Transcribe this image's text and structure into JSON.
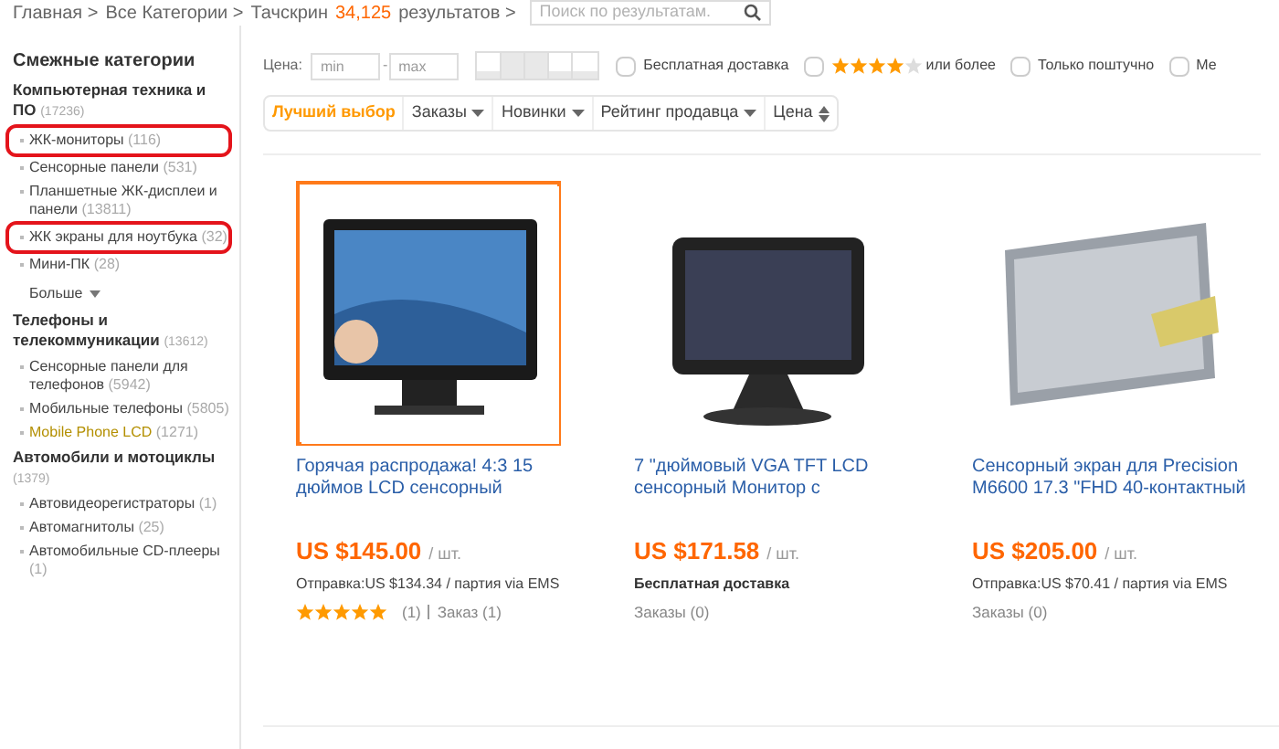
{
  "breadcrumb": {
    "items": [
      "Главная >",
      "Все Категории >",
      "Тачскрин"
    ],
    "count": "34,125",
    "suffix": "результатов >",
    "search_placeholder": "Поиск по результатам."
  },
  "sidebar": {
    "title": "Смежные категории",
    "groups": [
      {
        "name": "Компьютерная техника и ПО",
        "count": "(17236)",
        "items": [
          {
            "label": "ЖК-мониторы",
            "count": "(116)",
            "marked": true,
            "hover": false
          },
          {
            "label": "Сенсорные панели",
            "count": "(531)",
            "marked": false,
            "hover": false
          },
          {
            "label": "Планшетные ЖК-дисплеи и панели",
            "count": "(13811)",
            "marked": false,
            "hover": false
          },
          {
            "label": "ЖК экраны для ноутбука",
            "count": "(32)",
            "marked": true,
            "hover": false
          },
          {
            "label": "Мини-ПК",
            "count": "(28)",
            "marked": false,
            "hover": false
          }
        ],
        "more": "Больше"
      },
      {
        "name": "Телефоны и телекоммуникации",
        "count": "(13612)",
        "items": [
          {
            "label": "Сенсорные панели для телефонов",
            "count": "(5942)",
            "marked": false,
            "hover": false
          },
          {
            "label": "Мобильные телефоны",
            "count": "(5805)",
            "marked": false,
            "hover": false
          },
          {
            "label": "Mobile Phone LCD",
            "count": "(1271)",
            "marked": false,
            "hover": true
          }
        ]
      },
      {
        "name": "Автомобили и мотоциклы",
        "count": "(1379)",
        "items": [
          {
            "label": "Автовидеорегистраторы",
            "count": "(1)",
            "marked": false,
            "hover": false
          },
          {
            "label": "Автомагнитолы",
            "count": "(25)",
            "marked": false,
            "hover": false
          },
          {
            "label": "Автомобильные CD-плееры",
            "count": "(1)",
            "marked": false,
            "hover": false
          }
        ]
      }
    ]
  },
  "filters": {
    "price_label": "Цена:",
    "min_placeholder": "min",
    "dash": "-",
    "max_placeholder": "max",
    "checks": [
      {
        "kind": "text",
        "label": "Бесплатная доставка",
        "checked": false
      },
      {
        "kind": "stars",
        "stars": 4,
        "label": "или более",
        "checked": false
      },
      {
        "kind": "text",
        "label": "Только поштучно",
        "checked": false
      },
      {
        "kind": "text",
        "label": "Ме",
        "checked": false
      }
    ]
  },
  "sort": [
    {
      "label": "Лучший выбор",
      "selected": true,
      "kind": "plain"
    },
    {
      "label": "Заказы",
      "selected": false,
      "kind": "down"
    },
    {
      "label": "Новинки",
      "selected": false,
      "kind": "down"
    },
    {
      "label": "Рейтинг продавца",
      "selected": false,
      "kind": "down"
    },
    {
      "label": "Цена",
      "selected": false,
      "kind": "updown"
    }
  ],
  "products": [
    {
      "title": "Горячая распродажа! 4:3 15 дюймов LCD сенсорный",
      "price": "US $145.00",
      "unit": "/ шт.",
      "free_shipping": false,
      "shipping": "Отправка:US $134.34 / партия via EMS",
      "stars": 5,
      "reviews": "(1)",
      "orders": "Заказ (1)",
      "selected": true
    },
    {
      "title": "7 \"дюймовый VGA TFT LCD сенсорный Монитор с",
      "price": "US $171.58",
      "unit": "/ шт.",
      "free_shipping": true,
      "shipping": "Бесплатная доставка",
      "orders": "Заказы (0)",
      "selected": false
    },
    {
      "title": "Сенсорный экран для Precision M6600 17.3 \"FHD 40-контактный",
      "price": "US $205.00",
      "unit": "/ шт.",
      "free_shipping": false,
      "shipping": "Отправка:US $70.41 / партия via EMS",
      "orders": "Заказы (0)",
      "selected": false
    }
  ]
}
